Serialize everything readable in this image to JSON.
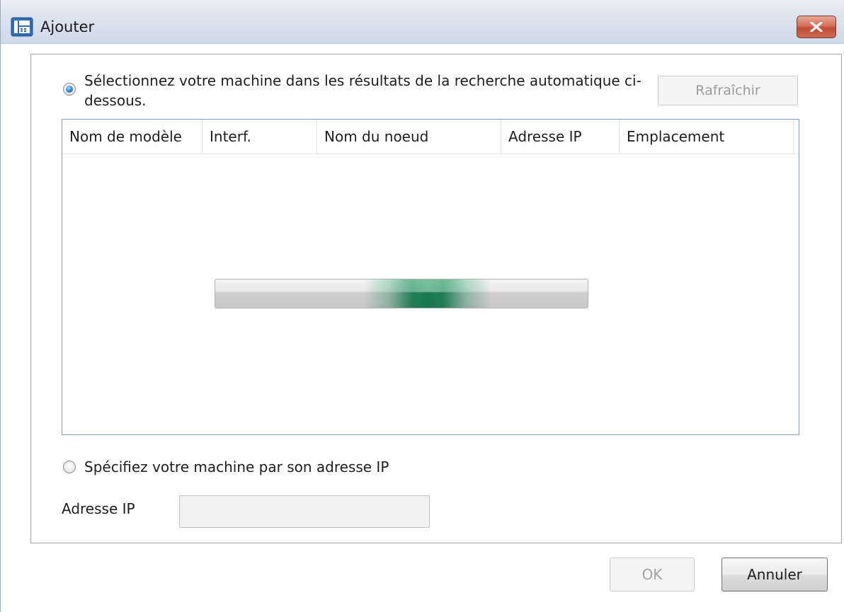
{
  "window": {
    "title": "Ajouter",
    "app_icon": "fax-machine-icon",
    "close_icon": "close-x-icon"
  },
  "auto_search": {
    "selected": true,
    "label": "Sélectionnez votre machine dans les résultats de la recherche automatique ci-dessous.",
    "refresh_button": "Rafraîchir",
    "refresh_enabled": false
  },
  "results_table": {
    "columns": [
      "Nom de modèle",
      "Interf.",
      "Nom du noeud",
      "Adresse IP",
      "Emplacement"
    ],
    "rows": [],
    "loading": true
  },
  "manual_ip": {
    "selected": false,
    "label": "Spécifiez votre machine par son adresse IP",
    "field_label": "Adresse IP",
    "field_value": "",
    "field_enabled": false
  },
  "footer": {
    "ok_label": "OK",
    "ok_enabled": false,
    "cancel_label": "Annuler"
  },
  "colors": {
    "progress_accent": "#068c50",
    "radio_selected": "#2f7fd3",
    "close_button": "#c94f38"
  }
}
